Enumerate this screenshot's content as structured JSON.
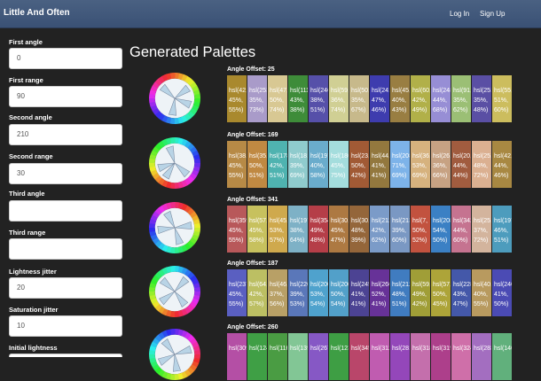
{
  "nav": {
    "brand": "Little And Often",
    "login": "Log In",
    "signup": "Sign Up"
  },
  "sidebar": {
    "fields": [
      {
        "label": "First angle",
        "value": "0"
      },
      {
        "label": "First range",
        "value": "90"
      },
      {
        "label": "Second angle",
        "value": "210"
      },
      {
        "label": "Second range",
        "value": "30"
      },
      {
        "label": "Third angle",
        "value": ""
      },
      {
        "label": "Third range",
        "value": ""
      },
      {
        "label": "Lightness jitter",
        "value": "20"
      },
      {
        "label": "Saturation jitter",
        "value": "10"
      },
      {
        "label": "Initial lightness",
        "value": ""
      }
    ]
  },
  "main": {
    "title": "Generated Palettes"
  },
  "palettes": [
    {
      "label": "Angle Offset: 25",
      "offset": 25,
      "arms": [
        40,
        100,
        175,
        300
      ],
      "swatches": [
        [
          "hsl(42,",
          "45%,",
          "55%)",
          "#a9892e"
        ],
        [
          "hsl(253,",
          "35%,",
          "73%)",
          "#a99bc9"
        ],
        [
          "hsl(47,",
          "50%,",
          "74%)",
          "#d8c893"
        ],
        [
          "hsl(111,",
          "43%,",
          "38%)",
          "#3e8c39"
        ],
        [
          "hsl(246,",
          "38%,",
          "51%)",
          "#5650a9"
        ],
        [
          "hsl(59,",
          "36%,",
          "74%)",
          "#d0cf94"
        ],
        [
          "hsl(50,",
          "35%,",
          "67%)",
          "#c7b98b"
        ],
        [
          "hsl(241,",
          "47%,",
          "46%)",
          "#3e3cae"
        ],
        [
          "hsl(45,",
          "40%,",
          "43%)",
          "#997e42"
        ],
        [
          "hsl(60,",
          "42%,",
          "49%)",
          "#b1b049"
        ],
        [
          "hsl(248,",
          "44%,",
          "68%)",
          "#978ed5"
        ],
        [
          "hsl(91,",
          "35%,",
          "62%)",
          "#9bbf75"
        ],
        [
          "hsl(251,",
          "35%,",
          "48%)",
          "#5a4fa4"
        ],
        [
          "hsl(55,",
          "51%,",
          "60%)",
          "#ccbd5e"
        ]
      ]
    },
    {
      "label": "Angle Offset: 169",
      "offset": 169,
      "arms": [
        120,
        200,
        240,
        330
      ],
      "swatches": [
        [
          "hsl(38,",
          "45%,",
          "55%)",
          "#b78a46"
        ],
        [
          "hsl(35,",
          "50%,",
          "51%)",
          "#c08942"
        ],
        [
          "hsl(178,",
          "42%,",
          "51%)",
          "#4fb3b0"
        ],
        [
          "hsl(181,",
          "39%,",
          "69%)",
          "#8fcbcd"
        ],
        [
          "hsl(197,",
          "40%,",
          "58%)",
          "#6aaccc"
        ],
        [
          "hsl(180,",
          "45%,",
          "75%)",
          "#a4dddd"
        ],
        [
          "hsl(23,",
          "50%,",
          "42%)",
          "#a15a35"
        ],
        [
          "hsl(44,",
          "41%,",
          "41%)",
          "#93783e"
        ],
        [
          "hsl(208,",
          "71%,",
          "69%)",
          "#7db3e9"
        ],
        [
          "hsl(36,",
          "53%,",
          "69%)",
          "#d6b27e"
        ],
        [
          "hsl(26,",
          "36%,",
          "66%)",
          "#c7a283"
        ],
        [
          "hsl(20,",
          "44%,",
          "44%)",
          "#a15c3f"
        ],
        [
          "hsl(25,",
          "48%,",
          "72%)",
          "#dbb091"
        ],
        [
          "hsl(42,",
          "44%,",
          "46%)",
          "#a88842"
        ]
      ]
    },
    {
      "label": "Angle Offset: 341",
      "offset": 341,
      "arms": [
        70,
        150,
        250,
        320
      ],
      "swatches": [
        [
          "hsl(359,",
          "45%,",
          "55%)",
          "#b8585a"
        ],
        [
          "hsl(57,",
          "45%,",
          "58%)",
          "#c7c15e"
        ],
        [
          "hsl(45,",
          "53%,",
          "57%)",
          "#cfa94d"
        ],
        [
          "hsl(197,",
          "38%,",
          "64%)",
          "#7eb1c6"
        ],
        [
          "hsl(354,",
          "49%,",
          "48%)",
          "#b53e48"
        ],
        [
          "hsl(30,",
          "45%,",
          "47%)",
          "#ad7942"
        ],
        [
          "hsl(30,",
          "48%,",
          "39%)",
          "#94663a"
        ],
        [
          "hsl(212,",
          "42%,",
          "62%)",
          "#7b9bc8"
        ],
        [
          "hsl(213,",
          "39%,",
          "60%)",
          "#7a98c3"
        ],
        [
          "hsl(7,",
          "50%,",
          "52%)",
          "#c2523f"
        ],
        [
          "hsl(208,",
          "54%,",
          "50%)",
          "#3b80c4"
        ],
        [
          "hsl(342,",
          "44%,",
          "60%)",
          "#c57390"
        ],
        [
          "hsl(25,",
          "37%,",
          "72%)",
          "#d3b49d"
        ],
        [
          "hsl(197,",
          "46%,",
          "51%)",
          "#4d9cbd"
        ]
      ]
    },
    {
      "label": "Angle Offset: 187",
      "offset": 187,
      "arms": [
        30,
        130,
        220,
        300
      ],
      "swatches": [
        [
          "hsl(237,",
          "45%,",
          "55%)",
          "#5a5fc1"
        ],
        [
          "hsl(64,",
          "42%,",
          "57%)",
          "#bcbf63"
        ],
        [
          "hsl(46,",
          "37%,",
          "56%)",
          "#b8a066"
        ],
        [
          "hsl(220,",
          "39%,",
          "53%)",
          "#5a77b9"
        ],
        [
          "hsl(200,",
          "53%,",
          "54%)",
          "#4fa2cd"
        ],
        [
          "hsl(200,",
          "50%,",
          "54%)",
          "#52a0c9"
        ],
        [
          "hsl(245,",
          "41%,",
          "41%)",
          "#4c4393"
        ],
        [
          "hsl(266,",
          "52%,",
          "41%)",
          "#673298"
        ],
        [
          "hsl(212,",
          "48%,",
          "51%)",
          "#407cc0"
        ],
        [
          "hsl(59,",
          "49%,",
          "42%)",
          "#a09e37"
        ],
        [
          "hsl(57,",
          "50%,",
          "45%)",
          "#ada439"
        ],
        [
          "hsl(228,",
          "43%,",
          "47%)",
          "#4458a9"
        ],
        [
          "hsl(40,",
          "40%,",
          "55%)",
          "#b89a5f"
        ],
        [
          "hsl(240,",
          "41%,",
          "50%)",
          "#4b4bb4"
        ]
      ]
    },
    {
      "label": "Angle Offset: 260",
      "offset": 260,
      "arms": [
        60,
        160,
        230,
        310
      ],
      "swatches": [
        [
          "hsl(309,",
          "",
          "",
          "#b44fa5"
        ],
        [
          "hsl(124,",
          "",
          "",
          "#3f9f45"
        ],
        [
          "hsl(116,",
          "",
          "",
          "#4a9c43"
        ],
        [
          "hsl(139,",
          "",
          "",
          "#82c695"
        ],
        [
          "hsl(267,",
          "",
          "",
          "#8658c5"
        ],
        [
          "hsl(123,",
          "",
          "",
          "#3e9e44"
        ],
        [
          "hsl(345,",
          "",
          "",
          "#b9466a"
        ],
        [
          "hsl(312,",
          "",
          "",
          "#c05cb0"
        ],
        [
          "hsl(281,",
          "",
          "",
          "#9447ba"
        ],
        [
          "hsl(318,",
          "",
          "",
          "#c46fac"
        ],
        [
          "hsl(319,",
          "",
          "",
          "#ad3f8b"
        ],
        [
          "hsl(324,",
          "",
          "",
          "#cf6fa9"
        ],
        [
          "hsl(283,",
          "",
          "",
          "#a36ec0"
        ],
        [
          "hsl(140,",
          "",
          "",
          "#61b07c"
        ]
      ]
    }
  ]
}
